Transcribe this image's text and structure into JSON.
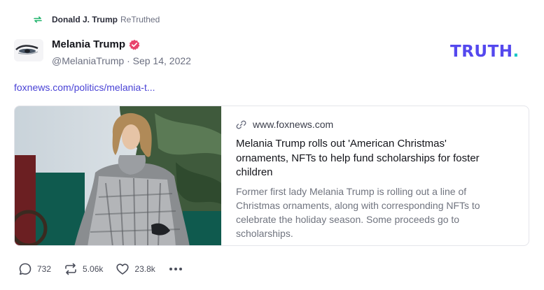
{
  "retruth": {
    "user": "Donald J. Trump",
    "action": "ReTruthed",
    "icon": "retruth-icon"
  },
  "author": {
    "name": "Melania Trump",
    "handle": "@MelaniaTrump",
    "separator": "·",
    "date": "Sep 14, 2022",
    "verified_icon": "verified-badge-icon"
  },
  "brand": {
    "logo_text": "TRUTH",
    "logo_dot": ".",
    "colors": {
      "primary": "#5448ee",
      "accent": "#17c6c6"
    }
  },
  "post": {
    "link_text": "foxnews.com/politics/melania-t..."
  },
  "card": {
    "domain": "www.foxnews.com",
    "title": "Melania Trump rolls out 'American Christmas' ornaments, NFTs to help fund scholarships for foster children",
    "description": "Former first lady Melania Trump is rolling out a line of Christmas ornaments, along with corresponding NFTs to celebrate the holiday season. Some proceeds go to scholarships."
  },
  "actions": {
    "replies": "732",
    "retruths": "5.06k",
    "likes": "23.8k"
  }
}
